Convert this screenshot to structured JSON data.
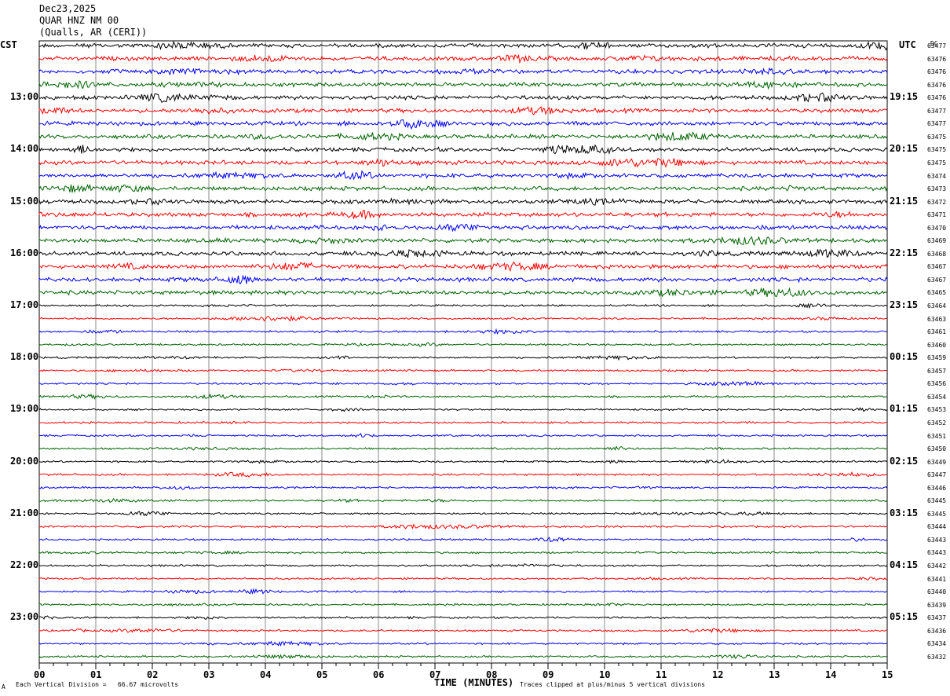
{
  "header": {
    "date": "Dec23,2025",
    "station": "QUAR HNZ NM 00",
    "location": "(Qualls, AR (CERI))"
  },
  "tz_left": "CST",
  "tz_right": "UTC",
  "dc_label": "DC",
  "footer": {
    "scale": "Each Vertical Division =   66.67 microvolts",
    "clip": "Traces clipped at plus/minus 5 vertical divisions",
    "corner": "A"
  },
  "chart_data": {
    "type": "line",
    "xlabel": "TIME (MINUTES)",
    "xlim": [
      0,
      15
    ],
    "x_ticks": [
      "00",
      "01",
      "02",
      "03",
      "04",
      "05",
      "06",
      "07",
      "08",
      "09",
      "10",
      "11",
      "12",
      "13",
      "14",
      "15"
    ],
    "left_hour_labels": [
      "13:00",
      "14:00",
      "15:00",
      "16:00",
      "17:00",
      "18:00",
      "19:00",
      "20:00",
      "21:00",
      "22:00",
      "23:00"
    ],
    "right_hour_labels": [
      "19:15",
      "20:15",
      "21:15",
      "22:15",
      "23:15",
      "00:15",
      "01:15",
      "02:15",
      "03:15",
      "04:15",
      "05:15"
    ],
    "trace_colors": [
      "#000000",
      "#ff0000",
      "#0000ff",
      "#006400"
    ],
    "dc_values": [
      "63477",
      "63476",
      "63476",
      "63476",
      "63476",
      "63477",
      "63477",
      "63475",
      "63475",
      "63475",
      "63474",
      "63473",
      "63472",
      "63471",
      "63470",
      "63469",
      "63468",
      "63467",
      "63467",
      "63465",
      "63464",
      "63463",
      "63461",
      "63460",
      "63459",
      "63457",
      "63456",
      "63454",
      "63453",
      "63452",
      "63451",
      "63450",
      "63449",
      "63447",
      "63446",
      "63445",
      "63445",
      "63444",
      "63443",
      "63443",
      "63442",
      "63441",
      "63440",
      "63439",
      "63437",
      "63436",
      "63434",
      "63432"
    ]
  }
}
